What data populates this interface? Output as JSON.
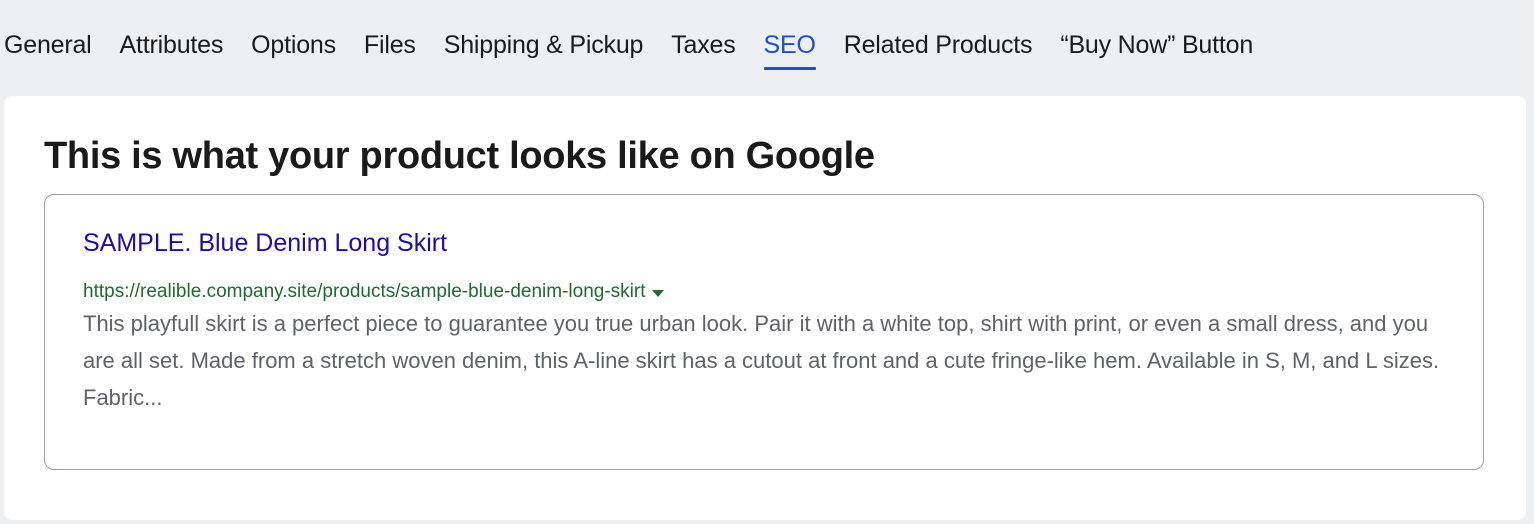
{
  "tabs": [
    {
      "label": "General",
      "active": false
    },
    {
      "label": "Attributes",
      "active": false
    },
    {
      "label": "Options",
      "active": false
    },
    {
      "label": "Files",
      "active": false
    },
    {
      "label": "Shipping & Pickup",
      "active": false
    },
    {
      "label": "Taxes",
      "active": false
    },
    {
      "label": "SEO",
      "active": true
    },
    {
      "label": "Related Products",
      "active": false
    },
    {
      "label": "“Buy Now” Button",
      "active": false
    }
  ],
  "colors": {
    "active_tab": "#1a4fd6",
    "result_title": "#1a0dab",
    "result_url": "#1e6b2b",
    "result_description": "#5f6368"
  },
  "seo_preview": {
    "heading": "This is what your product looks like on Google",
    "result_title": "SAMPLE. Blue Denim Long Skirt",
    "result_url": "https://realible.company.site/products/sample-blue-denim-long-skirt",
    "url_dropdown_icon": "caret-down-icon",
    "result_description": "This playfull skirt is a perfect piece to guarantee you true urban look. Pair it with a white top, shirt with print, or even a small dress, and you are all set. Made from a stretch woven denim, this A-line skirt has a cutout at front and a cute fringe-like hem. Available in S, M, and L sizes. Fabric..."
  }
}
